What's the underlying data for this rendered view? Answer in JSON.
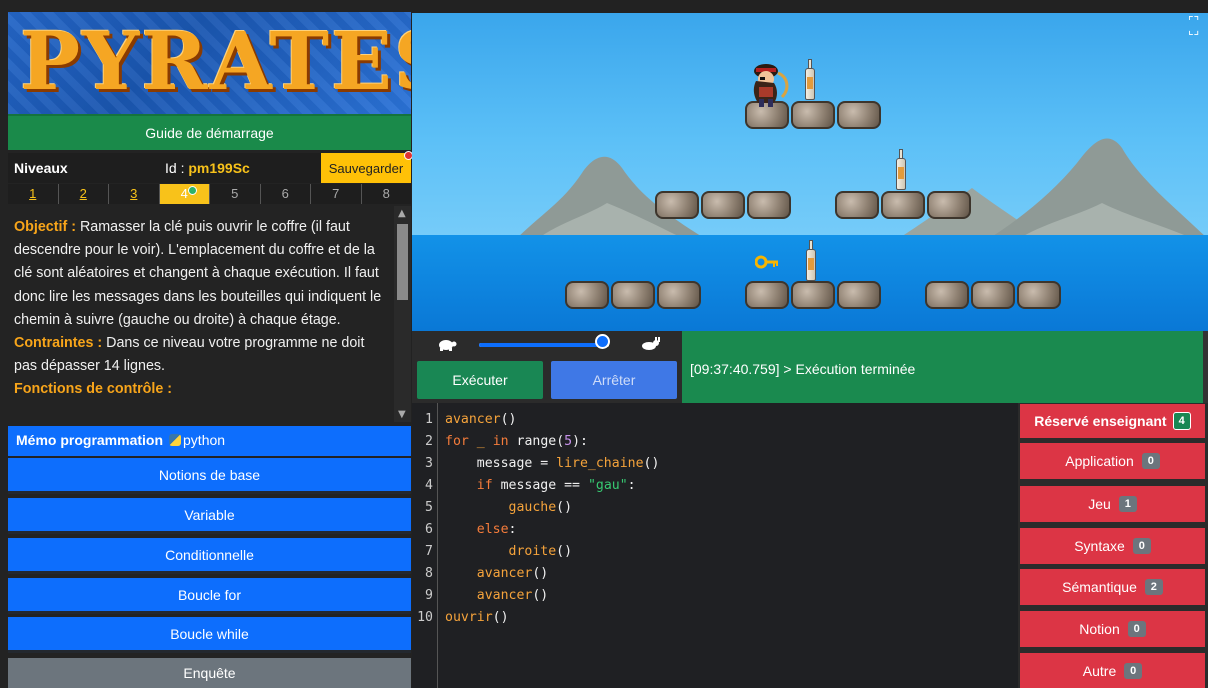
{
  "logo": {
    "text": "PYRATES"
  },
  "guide_button": "Guide de démarrage",
  "levels": {
    "title": "Niveaux",
    "id_label": "Id : ",
    "id_value": "pm199Sc",
    "save_label": "Sauvegarder",
    "tabs": [
      "1",
      "2",
      "3",
      "4",
      "5",
      "6",
      "7",
      "8"
    ],
    "current": "4"
  },
  "objective": {
    "objectif_label": "Objectif :",
    "objectif_text": " Ramasser la clé puis ouvrir le coffre (il faut descendre pour le voir). L'emplacement du coffre et de la clé sont aléatoires et changent à chaque exécution. Il faut donc lire les messages dans les bouteilles qui indiquent le chemin à suivre (gauche ou droite) à chaque étage.",
    "contraintes_label": "Contraintes :",
    "contraintes_text": " Dans ce niveau votre programme ne doit pas dépasser 14 lignes.",
    "fonctions_label": "Fonctions de contrôle :"
  },
  "memo": {
    "title": "Mémo programmation",
    "python_label": "python",
    "buttons": [
      "Notions de base",
      "Variable",
      "Conditionnelle",
      "Boucle for",
      "Boucle while"
    ],
    "enquete": "Enquête"
  },
  "controls": {
    "speed_percent": 95,
    "run_label": "Exécuter",
    "stop_label": "Arrêter"
  },
  "console": {
    "message": "[09:37:40.759] > Exécution terminée"
  },
  "editor": {
    "line_numbers": [
      "1",
      "2",
      "3",
      "4",
      "5",
      "6",
      "7",
      "8",
      "9",
      "10"
    ]
  },
  "teacher": {
    "title": "Réservé enseignant",
    "title_count": "4",
    "buttons": [
      {
        "label": "Application",
        "count": "0"
      },
      {
        "label": "Jeu",
        "count": "1"
      },
      {
        "label": "Syntaxe",
        "count": "0"
      },
      {
        "label": "Sémantique",
        "count": "2"
      },
      {
        "label": "Notion",
        "count": "0"
      },
      {
        "label": "Autre",
        "count": "0"
      }
    ]
  },
  "colors": {
    "green": "#198754",
    "blue": "#0d6efd",
    "red": "#dc3545",
    "yellow": "#ffc107",
    "orange_highlight": "#f8a51a"
  }
}
